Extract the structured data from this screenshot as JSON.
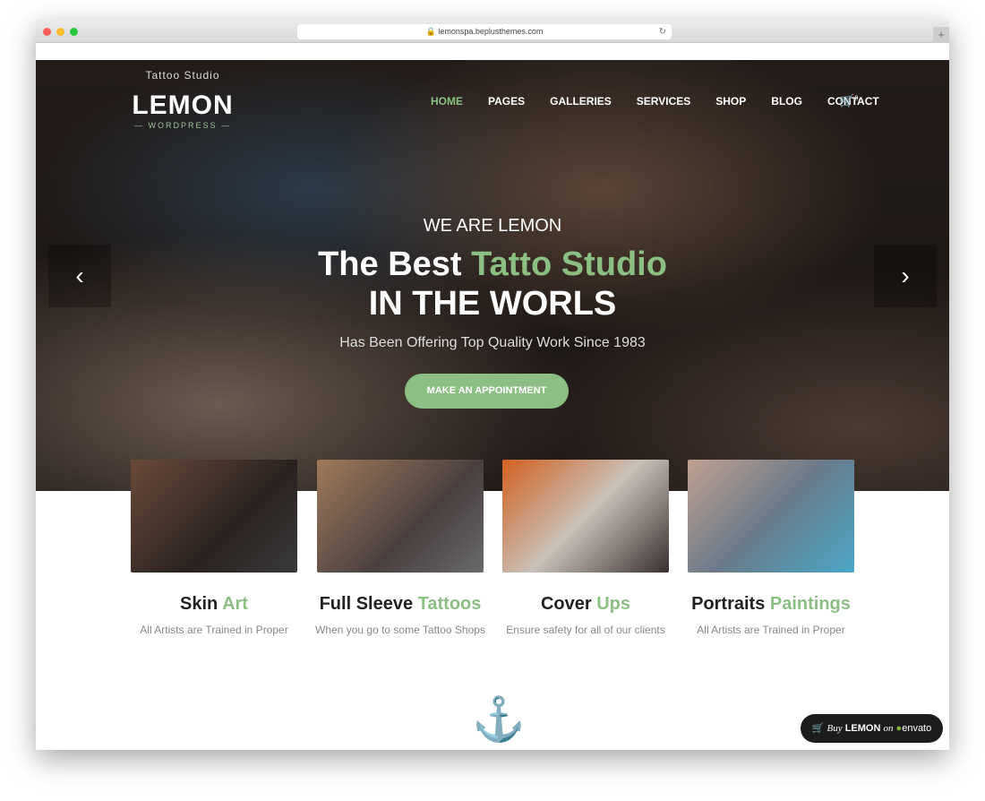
{
  "browser": {
    "url": "lemonspa.beplusthemes.com"
  },
  "logo": {
    "top": "Tattoo Studio",
    "name": "LEMON",
    "sub": "— WORDPRESS —"
  },
  "nav": [
    "HOME",
    "PAGES",
    "GALLERIES",
    "SERVICES",
    "SHOP",
    "BLOG",
    "CONTACT"
  ],
  "cart_count": "0",
  "hero": {
    "eyebrow": "WE ARE LEMON",
    "title_a": "The Best ",
    "title_b": "Tatto Studio",
    "title_c": "IN THE WORLS",
    "subtitle": "Has Been Offering Top Quality Work Since 1983",
    "cta": "MAKE AN APPOINTMENT"
  },
  "features": [
    {
      "a": "Skin ",
      "b": "Art",
      "desc": "All Artists are Trained in Proper"
    },
    {
      "a": "Full Sleeve ",
      "b": "Tattoos",
      "desc": "When you go to some Tattoo Shops"
    },
    {
      "a": "Cover ",
      "b": "Ups",
      "desc": "Ensure safety for all of our clients"
    },
    {
      "a": "Portraits ",
      "b": "Paintings",
      "desc": "All Artists are Trained in Proper"
    }
  ],
  "buy": {
    "a": "Buy",
    "b": "LEMON",
    "c": "on",
    "d": "envato"
  },
  "colors": {
    "accent": "#8cbf84"
  }
}
